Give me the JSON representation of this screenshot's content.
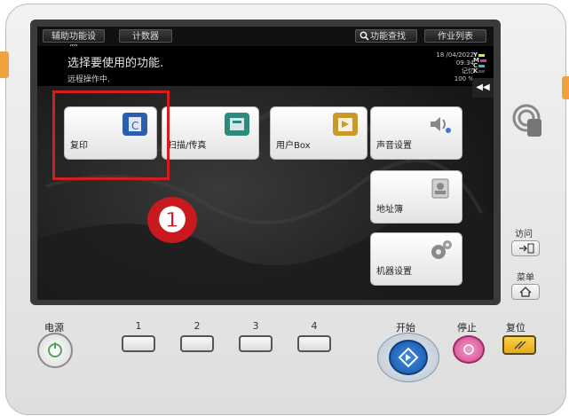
{
  "tabs": {
    "assist": "辅助功能设置",
    "counter": "计数器",
    "search": "功能查找",
    "job_list": "作业列表"
  },
  "header": {
    "prompt": "选择要使用的功能.",
    "remote_status": "远程操作中.",
    "date": "18 /04/2022",
    "time": "09:34",
    "memory_label": "记忆",
    "memory_value": "100 %",
    "toner_letters": [
      "Y",
      "M",
      "C",
      "K"
    ]
  },
  "tiles": {
    "copy": "复印",
    "scan_fax": "扫描/传真",
    "user_box": "用户Box",
    "sound": "声音设置",
    "address_book": "地址簿",
    "machine": "机器设置"
  },
  "annotation": {
    "step": "❶",
    "color": "#d21e1e"
  },
  "side": {
    "access": "访问",
    "menu": "菜单"
  },
  "panel": {
    "power": "电源",
    "keys": [
      "1",
      "2",
      "3",
      "4"
    ],
    "start": "开始",
    "stop": "停止",
    "reset": "复位"
  },
  "colors": {
    "accent_blue": "#1e6fd0",
    "stop_pink": "#d2418c",
    "reset_yellow": "#f3c020"
  }
}
